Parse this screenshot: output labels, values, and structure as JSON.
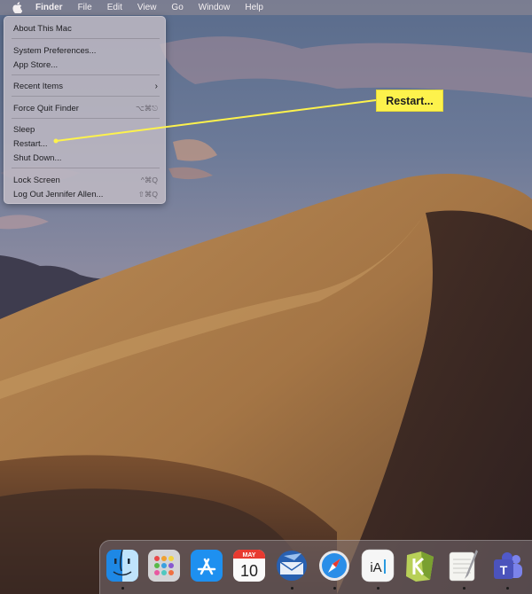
{
  "menubar": {
    "app_name": "Finder",
    "items": [
      "File",
      "Edit",
      "View",
      "Go",
      "Window",
      "Help"
    ]
  },
  "apple_menu": {
    "about": "About This Mac",
    "system_preferences": "System Preferences...",
    "app_store": "App Store...",
    "recent_items": "Recent Items",
    "force_quit": "Force Quit Finder",
    "force_quit_shortcut": "⌥⌘⎋",
    "sleep": "Sleep",
    "restart": "Restart...",
    "shut_down": "Shut Down...",
    "lock_screen": "Lock Screen",
    "lock_screen_shortcut": "^⌘Q",
    "log_out": "Log Out Jennifer Allen...",
    "log_out_shortcut": "⇧⌘Q"
  },
  "callout": {
    "label": "Restart...",
    "color": "#fdf24c"
  },
  "dock": {
    "calendar_month": "MAY",
    "calendar_day": "10",
    "ia_writer_label": "iA",
    "teams_label": "T",
    "apps": [
      "finder-icon",
      "launchpad-icon",
      "app-store-icon",
      "calendar-icon",
      "airmail-icon",
      "safari-icon",
      "ia-writer-icon",
      "keka-icon",
      "notes-icon",
      "teams-icon"
    ]
  }
}
